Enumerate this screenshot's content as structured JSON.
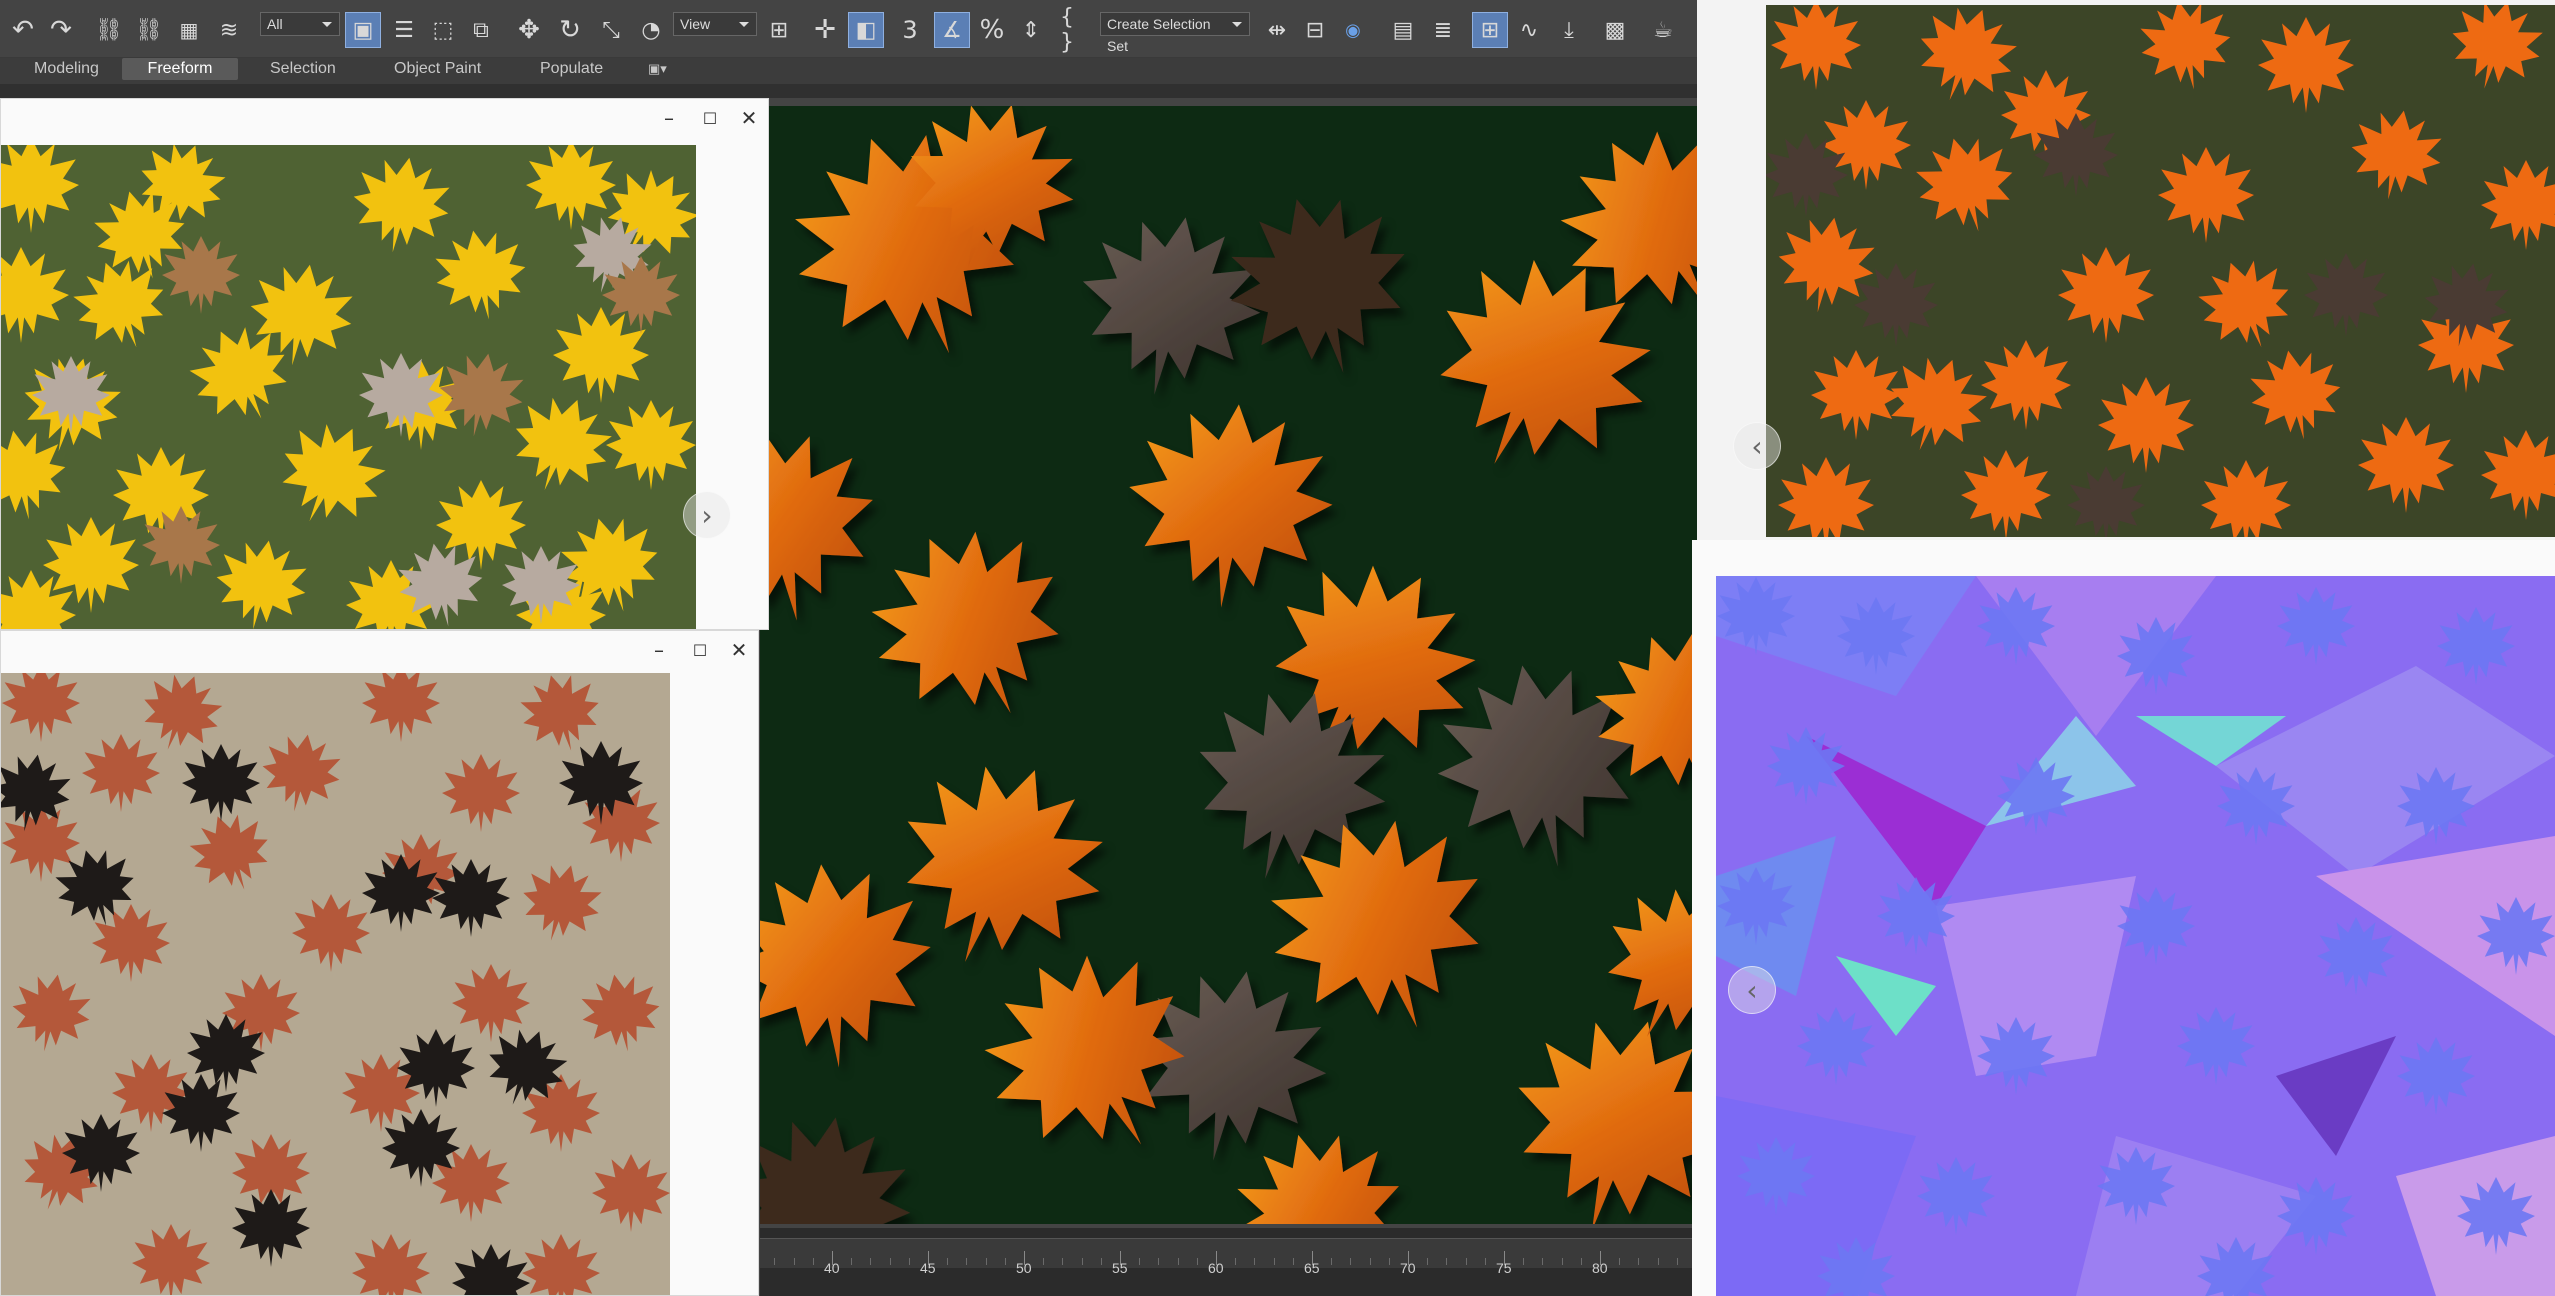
{
  "toolbar": {
    "filter_select": "All",
    "view_select": "View",
    "selection_set_select": "Create Selection Set",
    "snap_label": "3",
    "icons": [
      "undo-icon",
      "redo-icon",
      "link-icon",
      "unlink-icon",
      "bind-space-warp-icon",
      "select-object-icon",
      "select-by-name-icon",
      "rect-select-region-icon",
      "window-crossing-icon",
      "move-icon",
      "rotate-icon",
      "scale-icon",
      "place-icon",
      "pivot-center-icon",
      "mirror-icon",
      "align-icon",
      "layer-explorer-icon",
      "scene-explorer-icon",
      "curve-editor-icon",
      "material-editor-icon",
      "render-setup-icon",
      "render-icon"
    ]
  },
  "ribbon": {
    "tabs": [
      "Modeling",
      "Freeform",
      "Selection",
      "Object Paint",
      "Populate"
    ],
    "active_tab": "Freeform"
  },
  "timeline": {
    "labels": [
      "40",
      "45",
      "50",
      "55",
      "60",
      "65",
      "70",
      "75",
      "80"
    ]
  },
  "viewers": {
    "yellow_leaves": {
      "prev_next": "next",
      "bg": "#4f6233"
    },
    "brown_leaves": {
      "bg": "#b4a892"
    },
    "orange_leaves": {
      "prev_next": "previous",
      "bg": "#3c4527"
    },
    "normal_map": {
      "prev_next": "previous",
      "bg": "#8a6cf2"
    }
  },
  "colors": {
    "viewport_bg": "#0d2a13",
    "max_ui": "#444444",
    "active_button": "#5b7fb5"
  }
}
